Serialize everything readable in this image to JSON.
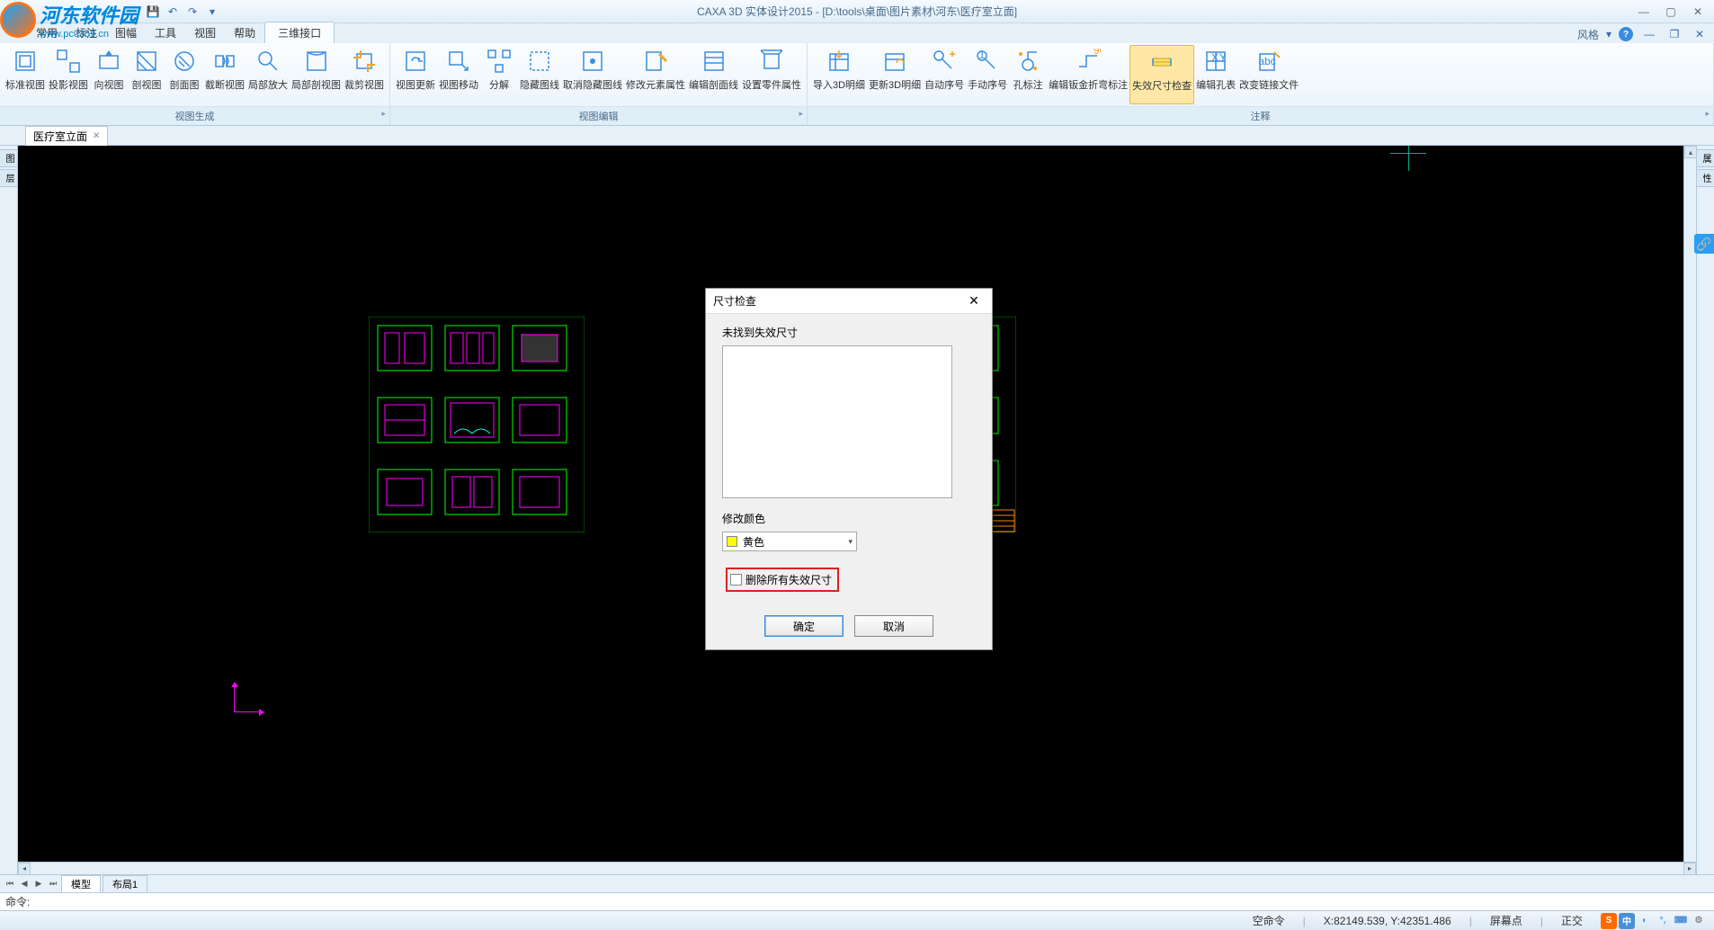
{
  "app": {
    "title": "CAXA 3D 实体设计2015 - [D:\\tools\\桌面\\图片素材\\河东\\医疗室立面]"
  },
  "watermark": {
    "title": "河东软件园",
    "url": "www.pc0359.cn"
  },
  "menu": {
    "items": [
      "常用",
      "标注",
      "图幅",
      "工具",
      "视图",
      "帮助",
      "三维接口"
    ],
    "active": "三维接口",
    "style_label": "风格",
    "style_dd": "▾"
  },
  "ribbon": {
    "groups": [
      {
        "label": "视图生成",
        "buttons": [
          {
            "name": "standard-view",
            "label": "标准视图"
          },
          {
            "name": "projection-view",
            "label": "投影视图"
          },
          {
            "name": "direction-view",
            "label": "向视图"
          },
          {
            "name": "section-view",
            "label": "剖视图"
          },
          {
            "name": "section-drawing",
            "label": "剖面图"
          },
          {
            "name": "broken-view",
            "label": "截断视图"
          },
          {
            "name": "local-enlarge",
            "label": "局部放大"
          },
          {
            "name": "local-section",
            "label": "局部剖视图"
          },
          {
            "name": "crop-view",
            "label": "裁剪视图"
          }
        ]
      },
      {
        "label": "视图编辑",
        "buttons": [
          {
            "name": "view-update",
            "label": "视图更新"
          },
          {
            "name": "view-move",
            "label": "视图移动"
          },
          {
            "name": "explode",
            "label": "分解"
          },
          {
            "name": "hide-lines",
            "label": "隐藏图线"
          },
          {
            "name": "unhide-lines",
            "label": "取消隐藏图线"
          },
          {
            "name": "edit-element-attr",
            "label": "修改元素属性"
          },
          {
            "name": "edit-section-line",
            "label": "编辑剖面线"
          },
          {
            "name": "set-part-attr",
            "label": "设置零件属性"
          }
        ]
      },
      {
        "label": "注释",
        "buttons": [
          {
            "name": "import-3d-bom",
            "label": "导入3D明细"
          },
          {
            "name": "update-3d-bom",
            "label": "更新3D明细"
          },
          {
            "name": "auto-number",
            "label": "自动序号"
          },
          {
            "name": "manual-number",
            "label": "手动序号"
          },
          {
            "name": "hole-callout",
            "label": "孔标注"
          },
          {
            "name": "edit-sheetmetal",
            "label": "编辑钣金折弯标注"
          },
          {
            "name": "invalid-dim-check",
            "label": "失效尺寸检查",
            "active": true
          },
          {
            "name": "edit-hole-table",
            "label": "编辑孔表"
          },
          {
            "name": "change-link-file",
            "label": "改变链接文件"
          }
        ]
      }
    ]
  },
  "doctab": {
    "title": "医疗室立面"
  },
  "bottomtabs": {
    "model": "模型",
    "layout": "布局1"
  },
  "cmdline": {
    "prompt": "命令:"
  },
  "statusbar": {
    "empty_cmd": "空命令",
    "coords": "X:82149.539, Y:42351.486",
    "screen_pt": "屏幕点",
    "ortho": "正交",
    "ime": [
      "S",
      "中"
    ]
  },
  "dialog": {
    "title": "尺寸检查",
    "not_found": "未找到失效尺寸",
    "mod_color": "修改颜色",
    "color_name": "黄色",
    "del_all": "删除所有失效尺寸",
    "ok": "确定",
    "cancel": "取消"
  }
}
